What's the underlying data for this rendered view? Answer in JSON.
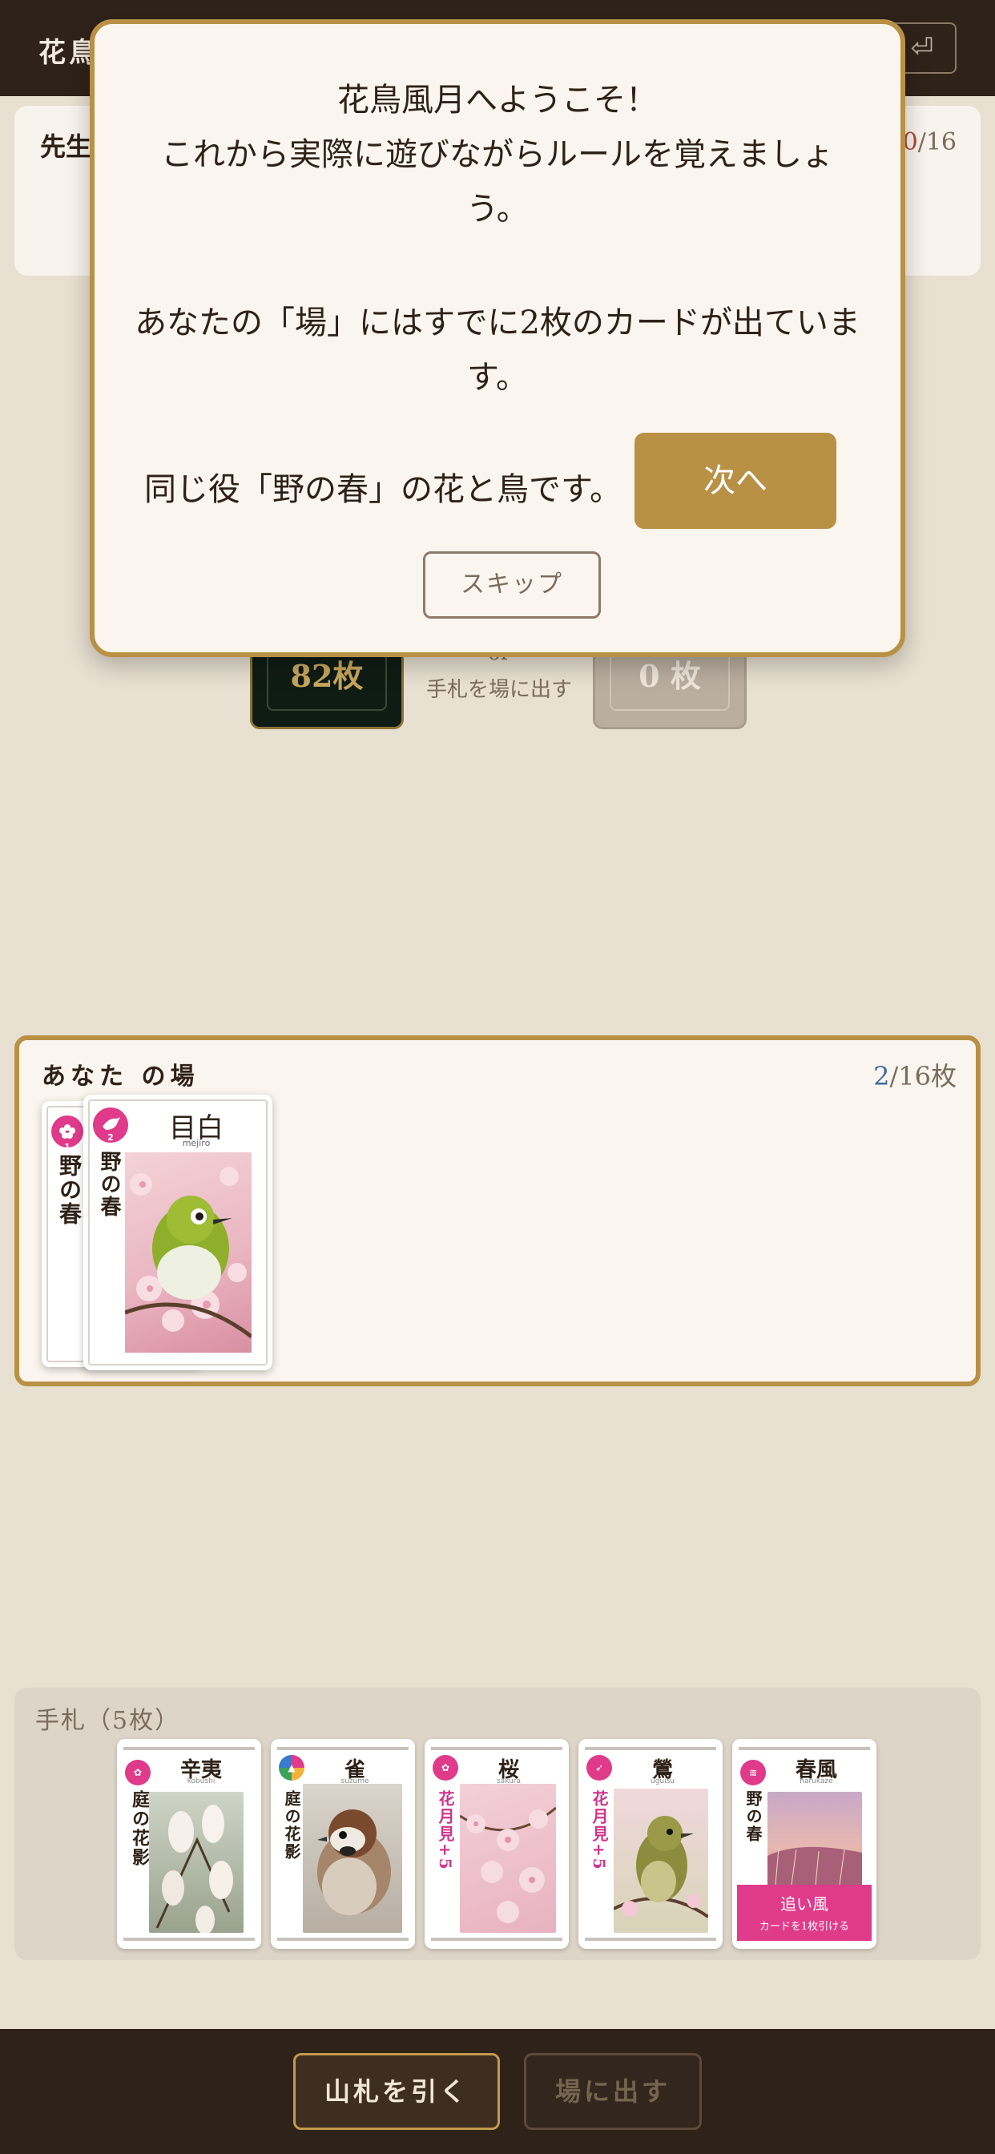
{
  "header": {
    "title": "花鳥",
    "exit_icon": "⏎"
  },
  "opponent": {
    "name": "先生",
    "count_current": "0",
    "count_total": "/16"
  },
  "deck": {
    "count": "82枚",
    "or": "or",
    "hint": "手札を場に出す",
    "discard_count": "0 枚"
  },
  "field": {
    "title": "あなた の場",
    "count_current": "2",
    "count_total": "/16枚",
    "cards": [
      {
        "badge": "1",
        "vertical": "野の春",
        "kind": "flower"
      },
      {
        "badge": "2",
        "name": "目白",
        "roman": "mejiro",
        "vertical": "野の春",
        "kind": "bird"
      }
    ]
  },
  "hand": {
    "title": "手札（5枚）",
    "cards": [
      {
        "name": "辛夷",
        "roman": "kobushi",
        "badge": "2",
        "vertical": "庭の花影",
        "kind": "flower"
      },
      {
        "name": "雀",
        "roman": "suzume",
        "badge": "1",
        "vertical": "庭の花影",
        "kind": "bird"
      },
      {
        "name": "桜",
        "roman": "sakura",
        "badge": "3",
        "vertical": "花月見+5",
        "kind": "flower"
      },
      {
        "name": "鶯",
        "roman": "uguisu",
        "badge": "2",
        "vertical": "花月見+5",
        "kind": "bird"
      },
      {
        "name": "春風",
        "roman": "harukaze",
        "badge": "1",
        "vertical": "野の春",
        "kind": "wind",
        "effect_title": "追い風",
        "effect_text": "カードを1枚引ける"
      }
    ]
  },
  "actions": {
    "draw": "山札を引く",
    "play": "場に出す"
  },
  "tutorial": {
    "line1": "花鳥風月へようこそ！",
    "line2": "これから実際に遊びながらルールを覚えましょ",
    "line3": "う。",
    "line4": "あなたの「場」にはすでに2枚のカードが出ていま",
    "line5": "す。",
    "line6": "同じ役「野の春」の花と鳥です。",
    "next": "次へ",
    "skip": "スキップ"
  },
  "colors": {
    "accent": "#b99145",
    "header": "#2f2219",
    "badge": "#e03a8a",
    "background": "#e8e0d1"
  }
}
